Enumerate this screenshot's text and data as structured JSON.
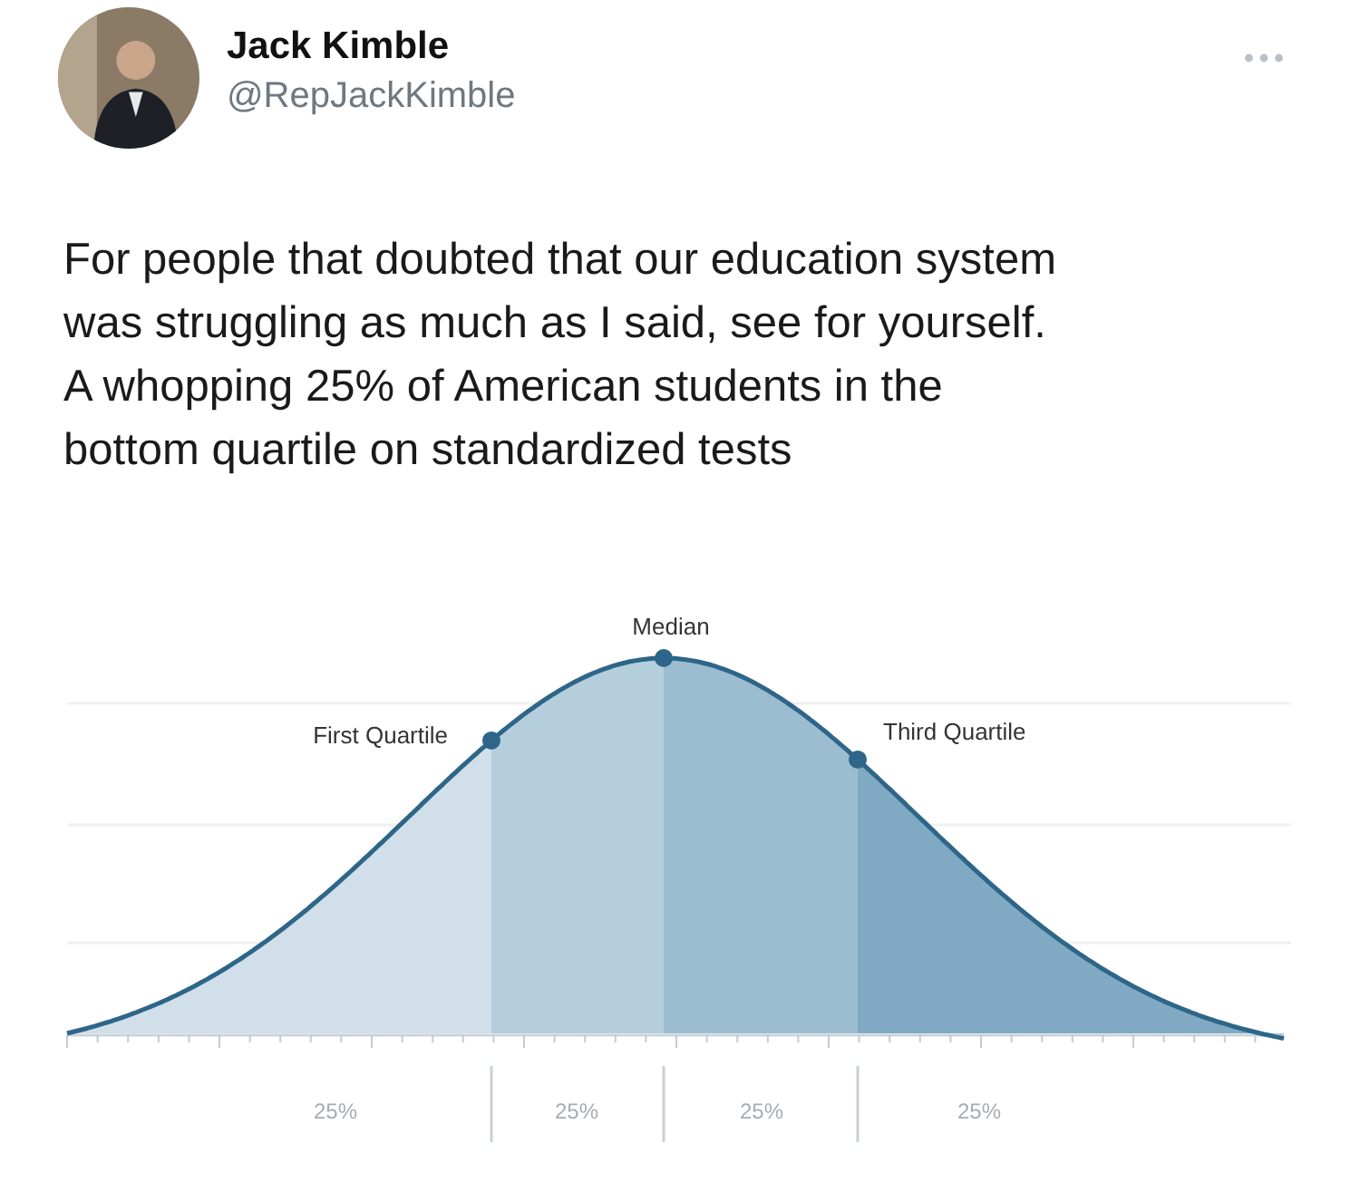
{
  "post": {
    "author": {
      "name": "Jack Kimble",
      "handle": "@RepJackKimble"
    },
    "text": "For people that doubted that our education system\nwas struggling as much as I said, see for yourself.\nA whopping 25% of American students in the\nbottom quartile on standardized tests"
  },
  "figure": {
    "median_label": "Median",
    "quartile_labels": [
      "First Quartile",
      "Third Quartile"
    ],
    "segments": [
      {
        "label": "25%",
        "color": "#d0dfe9"
      },
      {
        "label": "25%",
        "color": "#b4cedc"
      },
      {
        "label": "25%",
        "color": "#9cbdd0"
      },
      {
        "label": "25%",
        "color": "#80aac3"
      }
    ]
  }
}
